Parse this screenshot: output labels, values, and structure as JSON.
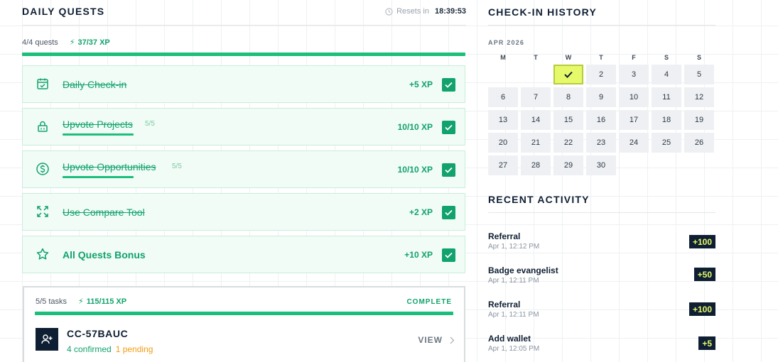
{
  "daily_quests": {
    "title": "DAILY QUESTS",
    "resets_label": "Resets in",
    "resets_time": "18:39:53",
    "summary_count": "4/4 quests",
    "summary_xp": "37/37 XP",
    "progress": 1.0,
    "quests": [
      {
        "name": "Daily Check-in",
        "count": "",
        "xp": "+5 XP",
        "done": true,
        "icon": "calendar-check-icon"
      },
      {
        "name": "Upvote Projects",
        "count": "5/5",
        "xp": "10/10 XP",
        "done": true,
        "icon": "lock-icon"
      },
      {
        "name": "Upvote Opportunities",
        "count": "5/5",
        "xp": "10/10 XP",
        "done": true,
        "icon": "dollar-circle-icon"
      },
      {
        "name": "Use Compare Tool",
        "count": "",
        "xp": "+2 XP",
        "done": true,
        "icon": "expand-arrows-icon"
      },
      {
        "name": "All Quests Bonus",
        "count": "",
        "xp": "+10 XP",
        "done": true,
        "icon": "star-icon"
      }
    ]
  },
  "tasks": {
    "summary_count": "5/5 tasks",
    "summary_xp": "115/115 XP",
    "status": "COMPLETE",
    "progress": 1.0,
    "referral": {
      "code": "CC-57BAUC",
      "confirmed": "4 confirmed",
      "pending": "1 pending",
      "view_label": "VIEW"
    }
  },
  "checkin": {
    "title": "CHECK-IN HISTORY",
    "month": "APR 2026",
    "weekdays": [
      "M",
      "T",
      "W",
      "T",
      "F",
      "S",
      "S"
    ],
    "days": [
      "2",
      "3",
      "4",
      "5",
      "6",
      "7",
      "8",
      "9",
      "10",
      "11",
      "12",
      "13",
      "14",
      "15",
      "16",
      "17",
      "18",
      "19",
      "20",
      "21",
      "22",
      "23",
      "24",
      "25",
      "26",
      "27",
      "28",
      "29",
      "30"
    ],
    "checked_day": "1"
  },
  "recent_activity": {
    "title": "RECENT ACTIVITY",
    "items": [
      {
        "name": "Referral",
        "time": "Apr 1, 12:12 PM",
        "points": "+100"
      },
      {
        "name": "Badge evangelist",
        "time": "Apr 1, 12:11 PM",
        "points": "+50"
      },
      {
        "name": "Referral",
        "time": "Apr 1, 12:11 PM",
        "points": "+100"
      },
      {
        "name": "Add wallet",
        "time": "Apr 1, 12:05 PM",
        "points": "+5"
      }
    ]
  },
  "colors": {
    "accent_green": "#12a26d",
    "progress_green": "#1cbf7a",
    "navy": "#0f1f33",
    "today_yellow": "#e6f96b",
    "pending_orange": "#f39c12"
  }
}
